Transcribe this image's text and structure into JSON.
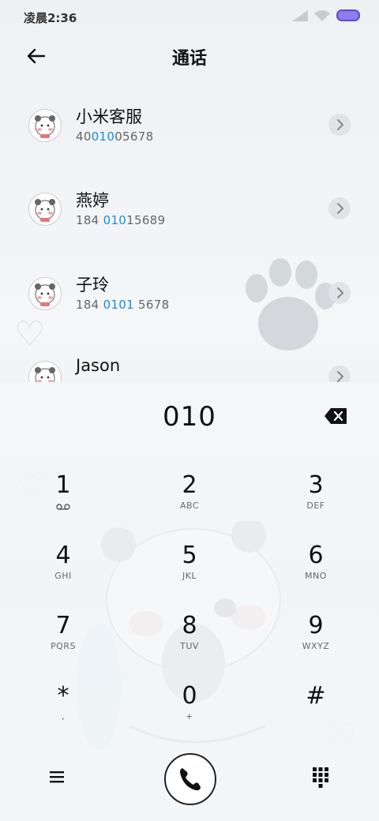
{
  "status": {
    "time": "凌晨2:36"
  },
  "header": {
    "title": "通话"
  },
  "contacts": [
    {
      "name": "小米客服",
      "pre": "40",
      "match": "010",
      "post": "05678"
    },
    {
      "name": "燕婷",
      "pre": "184 ",
      "match": "010",
      "post": "15689"
    },
    {
      "name": "子玲",
      "pre": "184 ",
      "match": "0101",
      "post": " 5678"
    },
    {
      "name": "Jason",
      "pre": "",
      "match": "",
      "post": ""
    }
  ],
  "dialpad": {
    "entered": "010",
    "keys": [
      {
        "num": "1",
        "sub": ""
      },
      {
        "num": "2",
        "sub": "ABC"
      },
      {
        "num": "3",
        "sub": "DEF"
      },
      {
        "num": "4",
        "sub": "GHI"
      },
      {
        "num": "5",
        "sub": "JKL"
      },
      {
        "num": "6",
        "sub": "MNO"
      },
      {
        "num": "7",
        "sub": "PQRS"
      },
      {
        "num": "8",
        "sub": "TUV"
      },
      {
        "num": "9",
        "sub": "WXYZ"
      },
      {
        "num": "*",
        "sub": ","
      },
      {
        "num": "0",
        "sub": "+"
      },
      {
        "num": "#",
        "sub": ""
      }
    ]
  },
  "icons": [
    "back-arrow-icon",
    "chevron-right-icon",
    "backspace-icon",
    "voicemail-icon",
    "menu-icon",
    "phone-icon",
    "dialpad-icon",
    "signal-icon",
    "wifi-icon",
    "battery-icon"
  ],
  "colors": {
    "highlight": "#1a8ce0",
    "battery": "#8e7cf0"
  }
}
